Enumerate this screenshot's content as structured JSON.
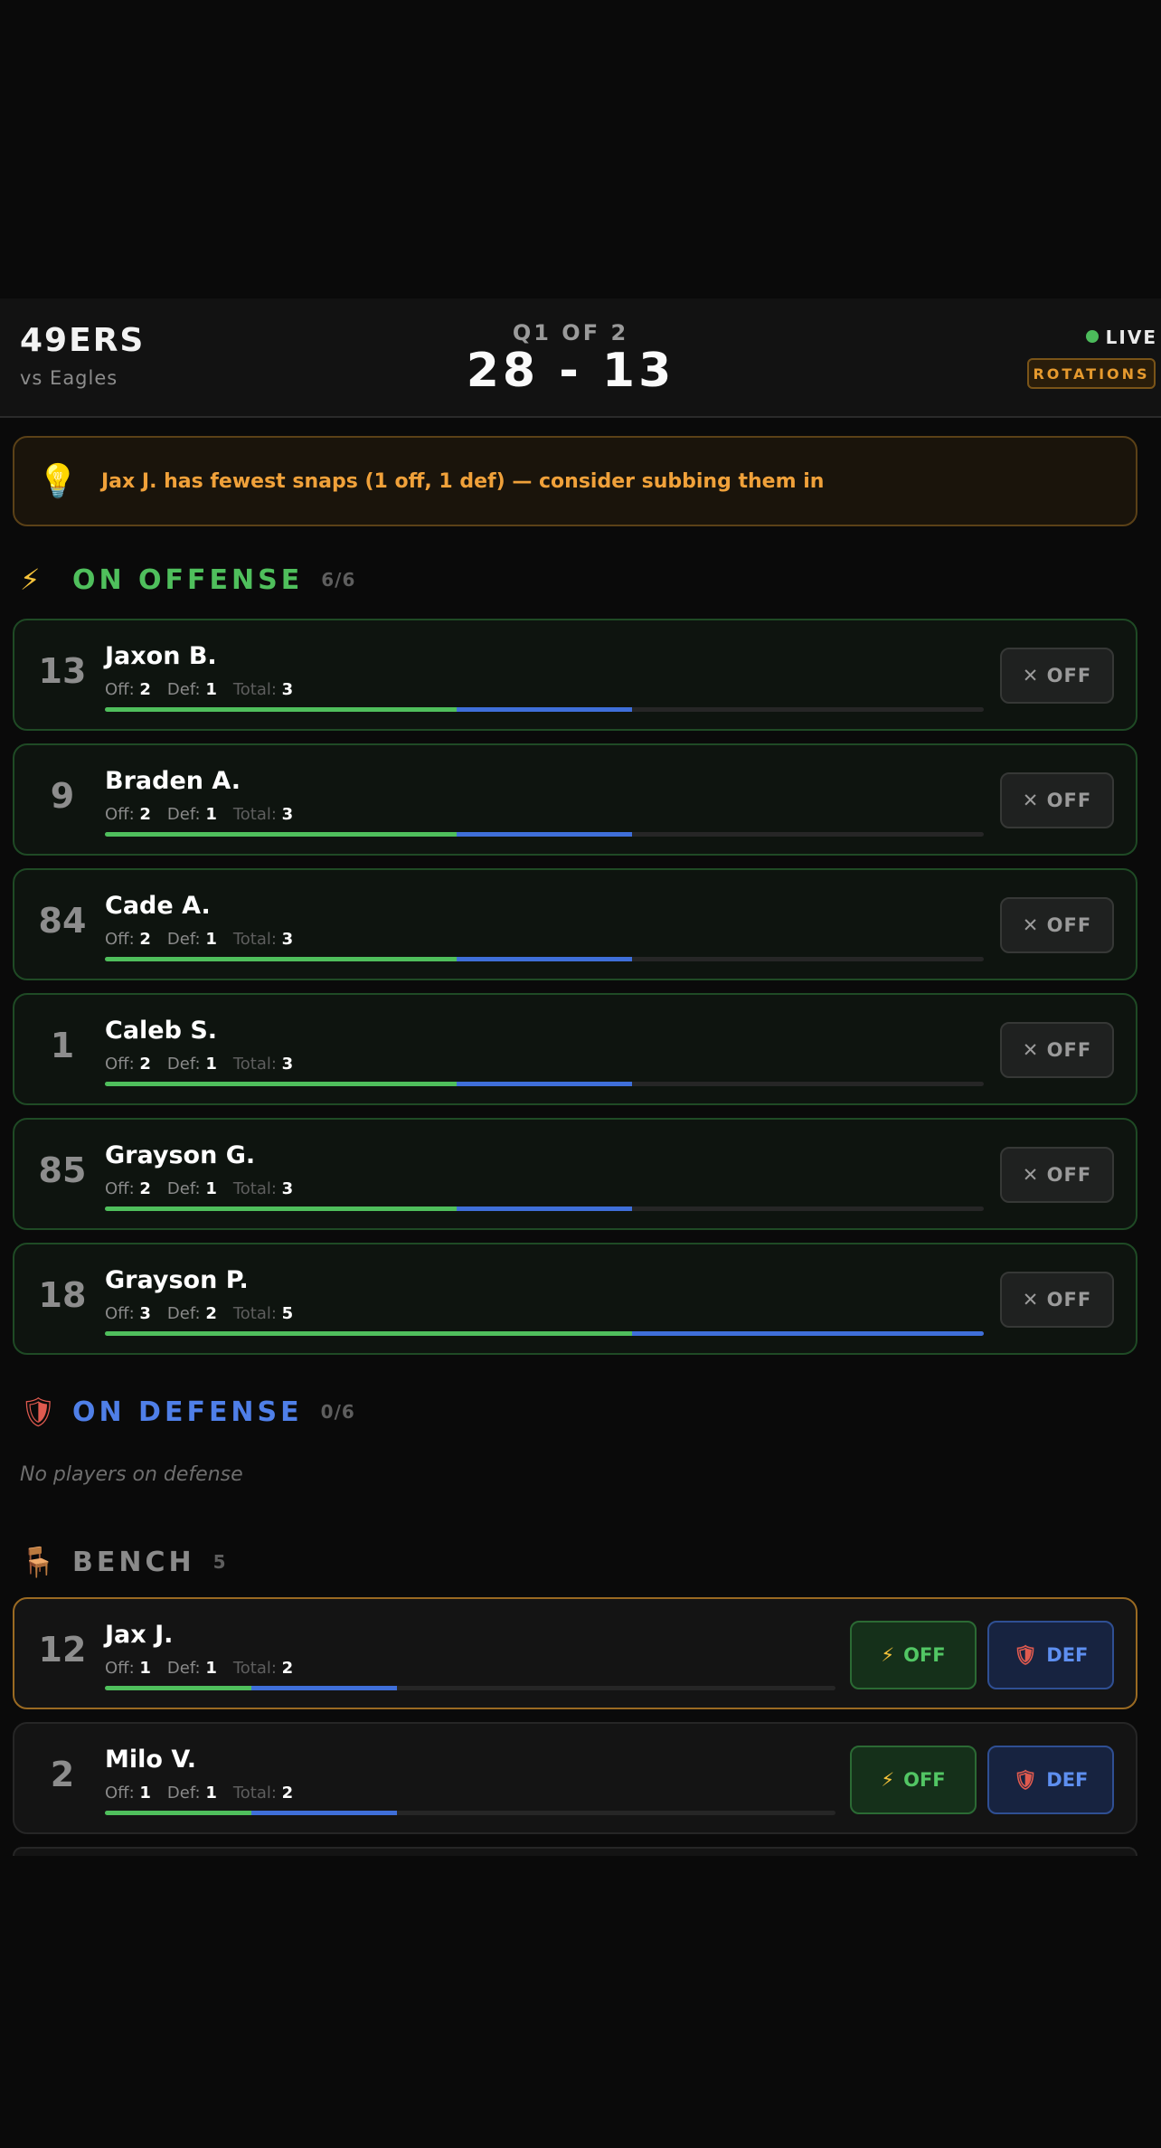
{
  "header": {
    "team": "49ERS",
    "opponent": "vs Eagles",
    "quarter": "Q1 OF 2",
    "score": "28 - 13",
    "live_label": "LIVE",
    "rotations_label": "ROTATIONS"
  },
  "tip": {
    "icon": "lightbulb-icon",
    "text": "Jax J. has fewest snaps (1 off, 1 def) — consider subbing them in"
  },
  "offense": {
    "icon": "lightning-icon",
    "title": "ON OFFENSE",
    "count": "6/6",
    "color": "#4fbf5c",
    "players": [
      {
        "number": "13",
        "name": "Jaxon B.",
        "off": 2,
        "def": 1,
        "total": 3,
        "button": "✕ OFF"
      },
      {
        "number": "9",
        "name": "Braden A.",
        "off": 2,
        "def": 1,
        "total": 3,
        "button": "✕ OFF"
      },
      {
        "number": "84",
        "name": "Cade A.",
        "off": 2,
        "def": 1,
        "total": 3,
        "button": "✕ OFF"
      },
      {
        "number": "1",
        "name": "Caleb S.",
        "off": 2,
        "def": 1,
        "total": 3,
        "button": "✕ OFF"
      },
      {
        "number": "85",
        "name": "Grayson G.",
        "off": 2,
        "def": 1,
        "total": 3,
        "button": "✕ OFF"
      },
      {
        "number": "18",
        "name": "Grayson P.",
        "off": 3,
        "def": 2,
        "total": 5,
        "button": "✕ OFF"
      }
    ]
  },
  "defense": {
    "icon": "shield-icon",
    "title": "ON DEFENSE",
    "count": "0/6",
    "color": "#4f7fe8",
    "empty_text": "No players on defense"
  },
  "bench": {
    "icon": "chair-icon",
    "title": "BENCH",
    "count": "5",
    "players": [
      {
        "number": "12",
        "name": "Jax J.",
        "off": 1,
        "def": 1,
        "total": 2,
        "off_button": "OFF",
        "def_button": "DEF",
        "highlighted": true
      },
      {
        "number": "2",
        "name": "Milo V.",
        "off": 1,
        "def": 1,
        "total": 2,
        "off_button": "OFF",
        "def_button": "DEF",
        "highlighted": false
      }
    ]
  },
  "labels": {
    "off": "Off:",
    "def": "Def:",
    "total": "Total:"
  },
  "colors": {
    "offense_bar": "#4fbf5c",
    "defense_bar": "#3f6fd9",
    "accent_orange": "#f0a13a",
    "live_dot": "#4cbb5b"
  }
}
